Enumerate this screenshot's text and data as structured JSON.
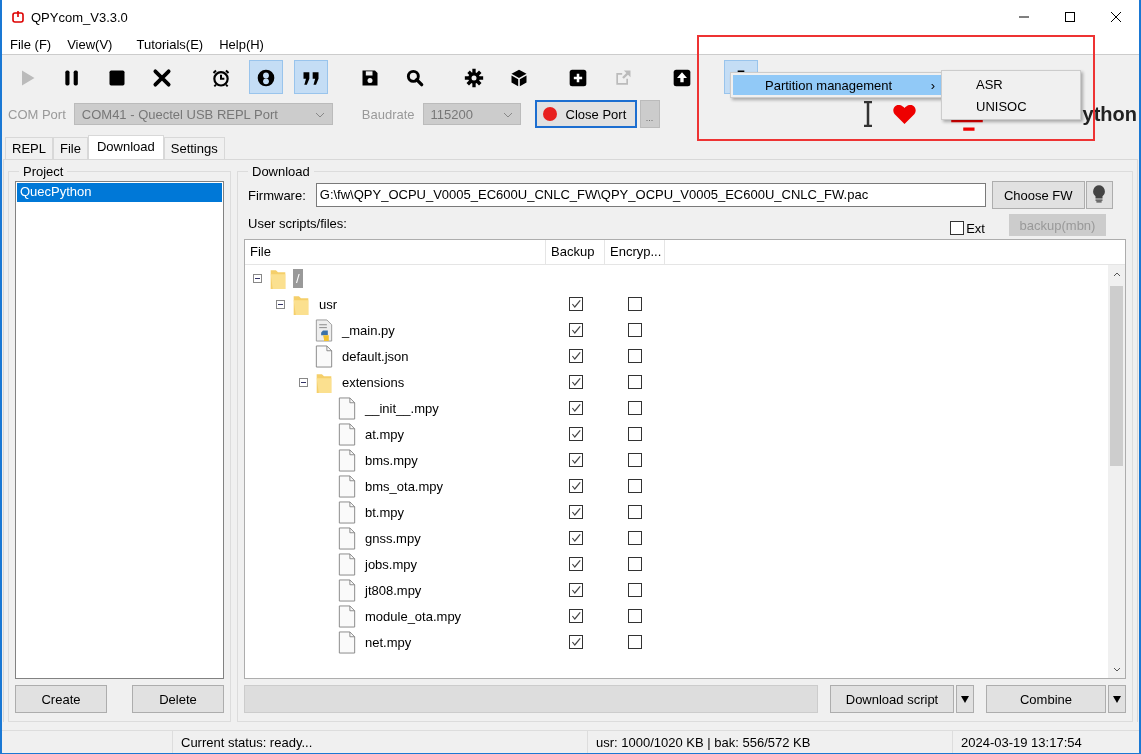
{
  "window": {
    "title": "QPYcom_V3.3.0"
  },
  "menu": [
    "File (F)",
    "View(V)",
    "Tutorials(E)",
    "Help(H)"
  ],
  "toolbar": [
    {
      "kind": "play",
      "selected": false,
      "disabled": true
    },
    {
      "kind": "pause",
      "selected": false,
      "disabled": false
    },
    {
      "kind": "stop",
      "selected": false,
      "disabled": false
    },
    {
      "kind": "close",
      "selected": false,
      "disabled": false
    },
    {
      "kind": "alarm",
      "selected": false,
      "disabled": false
    },
    {
      "kind": "ring",
      "selected": true,
      "disabled": false
    },
    {
      "kind": "quote",
      "selected": true,
      "disabled": false
    },
    {
      "kind": "save",
      "selected": false,
      "disabled": false
    },
    {
      "kind": "search",
      "selected": false,
      "disabled": false
    },
    {
      "kind": "gear",
      "selected": false,
      "disabled": false
    },
    {
      "kind": "cube",
      "selected": false,
      "disabled": false
    },
    {
      "kind": "plus",
      "selected": false,
      "disabled": false
    },
    {
      "kind": "share",
      "selected": false,
      "disabled": true
    },
    {
      "kind": "upload",
      "selected": false,
      "disabled": false
    },
    {
      "kind": "toolbox",
      "selected": true,
      "disabled": false
    }
  ],
  "port": {
    "label": "COM Port",
    "value": "COM41 - Quectel USB REPL Port",
    "baud_label": "Baudrate",
    "baud": "115200",
    "button": "Close Port",
    "more": "..."
  },
  "context_menu": {
    "item": "Partition management",
    "arrow": "›",
    "submenu": [
      "ASR",
      "UNISOC"
    ]
  },
  "logo_text": "ython",
  "tabs": [
    {
      "label": "REPL",
      "selected": false
    },
    {
      "label": "File",
      "selected": false
    },
    {
      "label": "Download",
      "selected": true
    },
    {
      "label": "Settings",
      "selected": false
    }
  ],
  "project": {
    "title": "Project",
    "items": [
      {
        "label": "QuecPython",
        "selected": true
      }
    ],
    "buttons": [
      "Create",
      "Delete"
    ]
  },
  "download": {
    "title": "Download",
    "firmware_label": "Firmware:",
    "firmware": "G:\\fw\\QPY_OCPU_V0005_EC600U_CNLC_FW\\QPY_OCPU_V0005_EC600U_CNLC_FW.pac",
    "choose": "Choose FW",
    "scripts_label": "User scripts/files:",
    "ext": {
      "label": "Ext",
      "checked": false
    },
    "backup_button": "backup(mbn)",
    "columns": [
      "File",
      "Backup",
      "Encryp..."
    ],
    "tree": [
      {
        "name": "/",
        "kind": "folder",
        "expanded": true,
        "selected": true,
        "children": [
          {
            "name": "usr",
            "kind": "folder",
            "expanded": true,
            "selected": false,
            "backup": true,
            "encrypt": false,
            "children": [
              {
                "name": "_main.py",
                "kind": "python",
                "selected": false,
                "backup": true,
                "encrypt": false
              },
              {
                "name": "default.json",
                "kind": "file",
                "selected": false,
                "backup": true,
                "encrypt": false
              },
              {
                "name": "extensions",
                "kind": "folder",
                "expanded": true,
                "selected": false,
                "backup": true,
                "encrypt": false,
                "children": [
                  {
                    "name": "__init__.mpy",
                    "kind": "file",
                    "selected": false,
                    "backup": true,
                    "encrypt": false
                  },
                  {
                    "name": "at.mpy",
                    "kind": "file",
                    "selected": false,
                    "backup": true,
                    "encrypt": false
                  },
                  {
                    "name": "bms.mpy",
                    "kind": "file",
                    "selected": false,
                    "backup": true,
                    "encrypt": false
                  },
                  {
                    "name": "bms_ota.mpy",
                    "kind": "file",
                    "selected": false,
                    "backup": true,
                    "encrypt": false
                  },
                  {
                    "name": "bt.mpy",
                    "kind": "file",
                    "selected": false,
                    "backup": true,
                    "encrypt": false
                  },
                  {
                    "name": "gnss.mpy",
                    "kind": "file",
                    "selected": false,
                    "backup": true,
                    "encrypt": false
                  },
                  {
                    "name": "jobs.mpy",
                    "kind": "file",
                    "selected": false,
                    "backup": true,
                    "encrypt": false
                  },
                  {
                    "name": "jt808.mpy",
                    "kind": "file",
                    "selected": false,
                    "backup": true,
                    "encrypt": false
                  },
                  {
                    "name": "module_ota.mpy",
                    "kind": "file",
                    "selected": false,
                    "backup": true,
                    "encrypt": false
                  },
                  {
                    "name": "net.mpy",
                    "kind": "file",
                    "selected": false,
                    "backup": true,
                    "encrypt": false
                  }
                ]
              }
            ]
          }
        ]
      }
    ],
    "progress": {
      "level": 0
    },
    "download_button": "Download script",
    "combine_button": "Combine"
  },
  "status_bar": {
    "status": "Current status: ready...",
    "usage": "usr: 1000/1020 KB | bak: 556/572 KB",
    "time": "2024-03-19 13:17:54"
  }
}
